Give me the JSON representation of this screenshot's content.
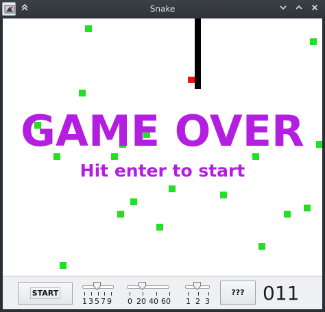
{
  "window": {
    "title": "Snake",
    "title_buttons": [
      "chevron-up-double",
      "chevron-down",
      "chevron-up",
      "close"
    ]
  },
  "game": {
    "headline": "GAME OVER",
    "subtitle": "Hit enter to start",
    "colors": {
      "text": "#b31ee0",
      "food": "#22e022",
      "snake": "#000000",
      "snake_head": "#ee1111",
      "background": "#ffffff"
    }
  },
  "controls": {
    "start_label": "START",
    "mystery_label": "???",
    "score": "011",
    "sliders": [
      {
        "name": "speed-slider",
        "tick_labels": [
          "1",
          "3",
          "5",
          "7",
          "9"
        ],
        "value": "5"
      },
      {
        "name": "obstacles-slider",
        "tick_labels": [
          "0",
          "20",
          "40",
          "60"
        ],
        "value": "20"
      },
      {
        "name": "level-slider",
        "tick_labels": [
          "1",
          "2",
          "3"
        ],
        "value": "2"
      }
    ]
  }
}
